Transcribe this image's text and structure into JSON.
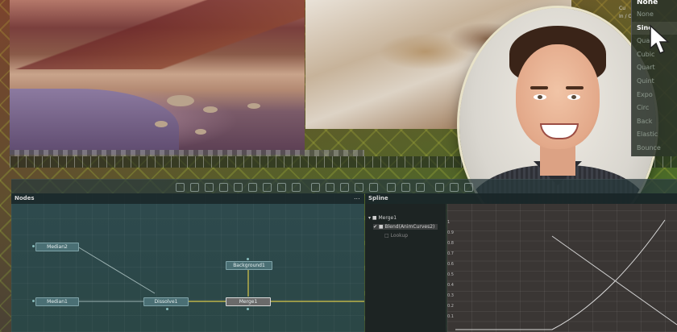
{
  "easing_menu": {
    "selected": "None",
    "options": [
      "None",
      "Sine",
      "Quad",
      "Cubic",
      "Quart",
      "Quint",
      "Expo",
      "Circ",
      "Back",
      "Elastic",
      "Bounce"
    ],
    "active_index": 1
  },
  "side_labels": [
    "Cu",
    "In / O"
  ],
  "nodes_panel": {
    "title": "Nodes",
    "nodes": {
      "median2": "Median2",
      "median1": "Median1",
      "dissolve1": "Dissolve1",
      "background1": "Background1",
      "merge1": "Merge1"
    }
  },
  "spline_panel": {
    "title": "Spline",
    "more": "...",
    "tree": {
      "merge": "Merge1",
      "blend": "Blend(AnimCurves2)",
      "lookup": "Lookup"
    },
    "y_ticks": [
      "1",
      "0.9",
      "0.8",
      "0.7",
      "0.6",
      "0.5",
      "0.4",
      "0.3",
      "0.2",
      "0.1"
    ]
  },
  "colors": {
    "accent": "#d8c84a",
    "node_fill": "#4a6f74",
    "wire": "#9ab0b0",
    "wire_active": "#d8c84a"
  },
  "icons": [
    "mouse-pointer-icon",
    "toolbar-tool-icon"
  ]
}
